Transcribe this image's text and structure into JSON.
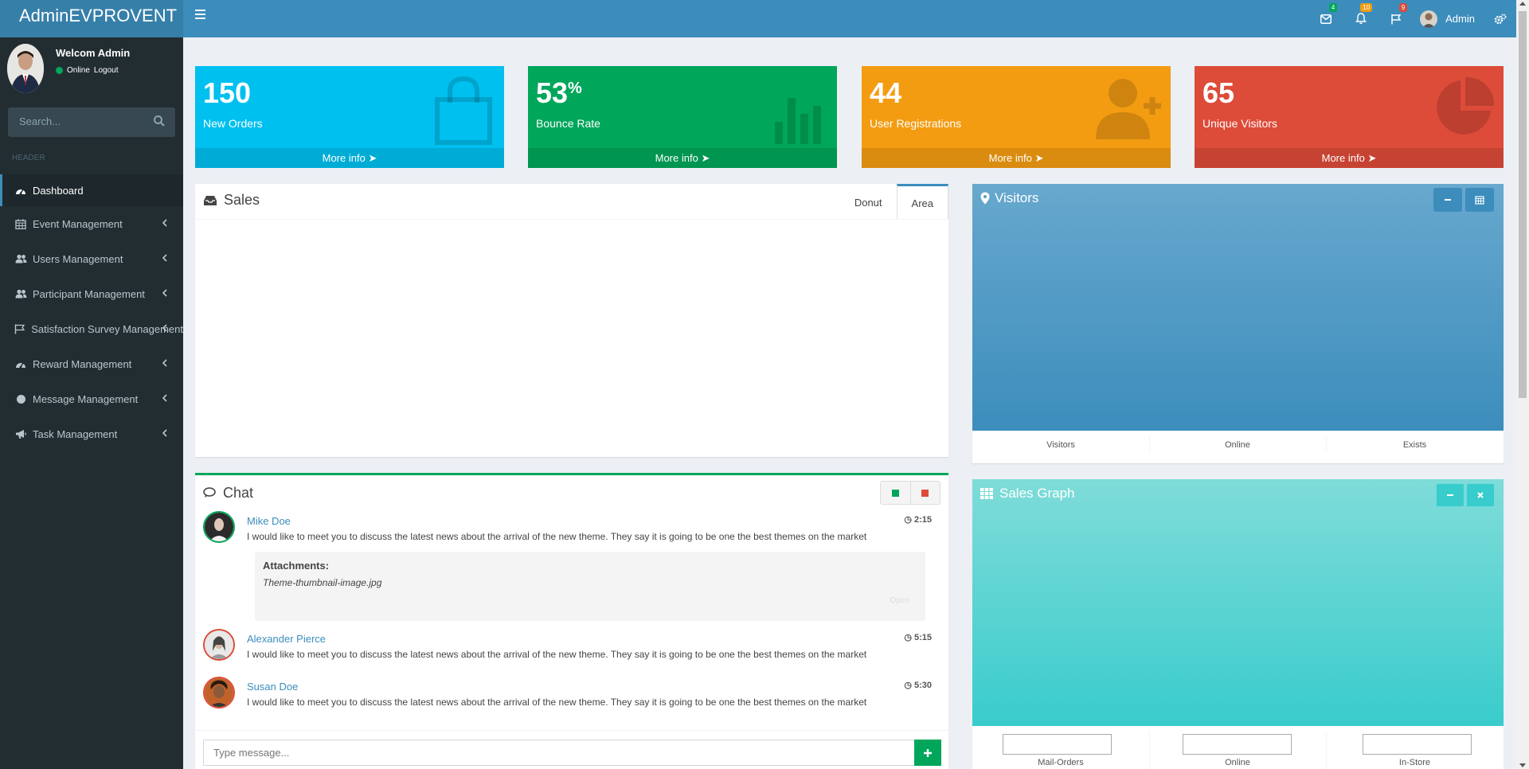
{
  "header": {
    "logo": "AdminEVPROVENT",
    "mail_badge": "4",
    "notify_badge": "10",
    "flag_badge": "9",
    "user_name": "Admin",
    "colors": {
      "bar": "#3c8dbc",
      "logo": "#367fa9"
    }
  },
  "sidebar": {
    "welcome": "Welcom Admin",
    "status": "Online",
    "logout": "Logout",
    "search_placeholder": "Search...",
    "header_label": "HEADER",
    "items": [
      {
        "label": "Dashboard",
        "icon": "dashboard-icon"
      },
      {
        "label": "Event Management",
        "icon": "calendar-icon"
      },
      {
        "label": "Users Management",
        "icon": "users-icon"
      },
      {
        "label": "Participant Management",
        "icon": "users-icon"
      },
      {
        "label": "Satisfaction Survey Management",
        "icon": "flag-icon"
      },
      {
        "label": "Reward Management",
        "icon": "dashboard-icon"
      },
      {
        "label": "Message Management",
        "icon": "circle-icon"
      },
      {
        "label": "Task Management",
        "icon": "bullhorn-icon"
      }
    ]
  },
  "stats": [
    {
      "value": "150",
      "suffix": "",
      "label": "New Orders",
      "more": "More info",
      "color": "#00c0ef",
      "icon": "shopping-bag-icon"
    },
    {
      "value": "53",
      "suffix": "%",
      "label": "Bounce Rate",
      "more": "More info",
      "color": "#00a65a",
      "icon": "bar-chart-icon"
    },
    {
      "value": "44",
      "suffix": "",
      "label": "User Registrations",
      "more": "More info",
      "color": "#f39c12",
      "icon": "user-plus-icon"
    },
    {
      "value": "65",
      "suffix": "",
      "label": "Unique Visitors",
      "more": "More info",
      "color": "#dd4b39",
      "icon": "pie-chart-icon"
    }
  ],
  "sales": {
    "title": "Sales",
    "tabs": [
      "Donut",
      "Area"
    ],
    "active_tab": "Area"
  },
  "visitors": {
    "title": "Visitors",
    "stats": [
      "Visitors",
      "Online",
      "Exists"
    ]
  },
  "sales_graph": {
    "title": "Sales Graph",
    "stats": [
      "Mail-Orders",
      "Online",
      "In-Store"
    ]
  },
  "chat": {
    "title": "Chat",
    "messages": [
      {
        "name": "Mike Doe",
        "time": "2:15",
        "text": "I would like to meet you to discuss the latest news about the arrival of the new theme. They say it is going to be one the best themes on the market",
        "border": "#00a65a"
      },
      {
        "name": "Alexander Pierce",
        "time": "5:15",
        "text": "I would like to meet you to discuss the latest news about the arrival of the new theme. They say it is going to be one the best themes on the market",
        "border": "#dd4b39"
      },
      {
        "name": "Susan Doe",
        "time": "5:30",
        "text": "I would like to meet you to discuss the latest news about the arrival of the new theme. They say it is going to be one the best themes on the market",
        "border": "#dd4b39"
      }
    ],
    "attachment_title": "Attachments:",
    "attachment_file": "Theme-thumbnail-image.jpg",
    "attachment_open": "Open",
    "input_placeholder": "Type message..."
  }
}
